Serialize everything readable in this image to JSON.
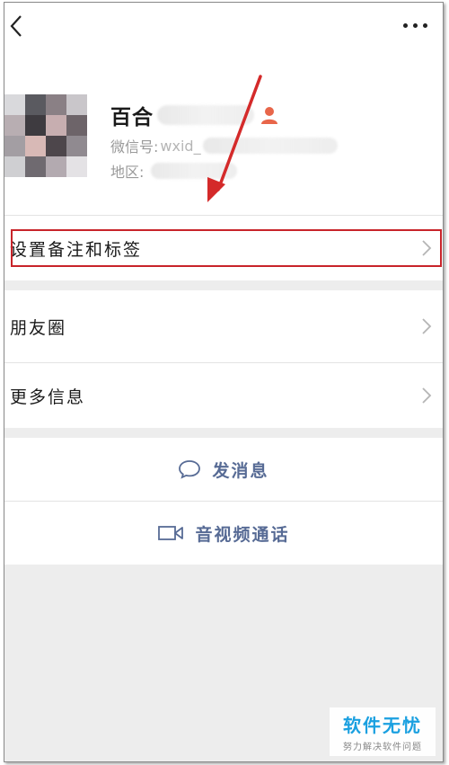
{
  "profile": {
    "nickname": "百合",
    "wechat_id_label": "微信号:",
    "wechat_id_value": "wxid_",
    "region_label": "地区:"
  },
  "menu": {
    "remark_tags": "设置备注和标签",
    "moments": "朋友圈",
    "more_info": "更多信息"
  },
  "actions": {
    "send_message": "发消息",
    "av_call": "音视频通话"
  },
  "watermark": {
    "brand": "软件无忧",
    "slogan": "努力解决软件问题"
  },
  "icons": {
    "back": "chevron-left-icon",
    "more": "more-dots-icon",
    "person": "person-icon",
    "chevron": "chevron-right-icon",
    "chat": "chat-bubble-icon",
    "video": "video-camera-icon"
  },
  "colors": {
    "accent_link": "#576b95",
    "highlight_box": "#c8242a",
    "annotation_arrow": "#d42a2a",
    "person_icon": "#e8664a",
    "page_bg": "#ededed",
    "watermark_brand": "#1aa0e0"
  }
}
